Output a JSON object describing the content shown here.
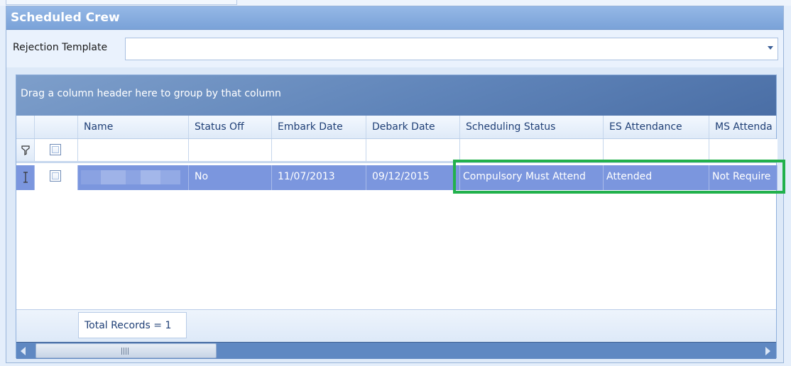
{
  "panel": {
    "title": "Scheduled Crew"
  },
  "template": {
    "label": "Rejection Template",
    "value": ""
  },
  "grid": {
    "group_panel_text": "Drag a column header here to group by that column",
    "columns": [
      "Name",
      "Status Off",
      "Embark Date",
      "Debark Date",
      "Scheduling Status",
      "ES Attendance",
      "MS Attenda"
    ],
    "rows": [
      {
        "name": "",
        "status_off": "No",
        "embark_date": "11/07/2013",
        "debark_date": "09/12/2015",
        "scheduling_status": "Compulsory Must Attend",
        "es_attendance": "Attended",
        "ms_attendance": "Not Require"
      }
    ],
    "footer": {
      "total_records": "Total Records = 1"
    },
    "filter_icon": "funnel-icon",
    "row_indicator_icon": "text-cursor-icon"
  },
  "colors": {
    "header": "#7aa2d8",
    "selected_row": "#7b96de",
    "highlight": "#22b14c"
  }
}
